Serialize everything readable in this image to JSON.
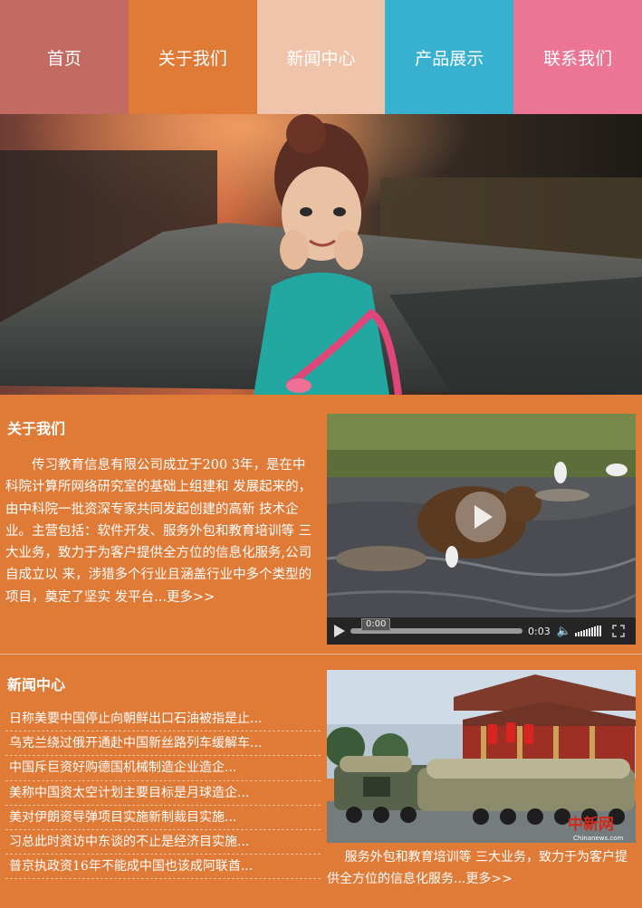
{
  "nav": {
    "items": [
      {
        "label": "首页"
      },
      {
        "label": "关于我们"
      },
      {
        "label": "新闻中心"
      },
      {
        "label": "产品展示"
      },
      {
        "label": "联系我们"
      }
    ]
  },
  "about": {
    "title": "关于我们",
    "body": "传习教育信息有限公司成立于200 3年，是在中科院计算所网络研究室的基础上组建和 发展起来的，由中科院一批资深专家共同发起创建的高新 技术企业。主营包括：软件开发、服务外包和教育培训等 三大业务，致力于为客户提供全方位的信息化服务,公司自成立以 来，涉猎多个行业且涵盖行业中多个类型的项目，奠定了坚实 发平台",
    "more": "...更多>>",
    "video": {
      "current_time": "0:00",
      "duration": "0:03"
    }
  },
  "news": {
    "title": "新闻中心",
    "items": [
      "日称美要中国停止向朝鲜出口石油被指是止...",
      "乌克兰绕过俄开通赴中国新丝路列车缓解车...",
      "中国斥巨资好购德国机械制造企业造企...",
      "美称中国资太空计划主要目标是月球造企...",
      "美对伊朗资导弹项目实施新制裁目实施...",
      "习总此时资访中东谈的不止是经济目实施...",
      "普京执政资16年不能成中国也该成阿联酋..."
    ],
    "image_watermark": "中新网",
    "image_watermark_sub": "Chinanews.com",
    "caption": "服务外包和教育培训等 三大业务，致力于为客户提供全方位的信息化服务",
    "more": "...更多>>"
  },
  "colors": {
    "nav_home": "#c36b62",
    "nav_about": "#e07a37",
    "nav_news": "#efc4aa",
    "nav_products": "#38b1d0",
    "nav_contact": "#ec7495",
    "page_bg": "#e07a37"
  }
}
